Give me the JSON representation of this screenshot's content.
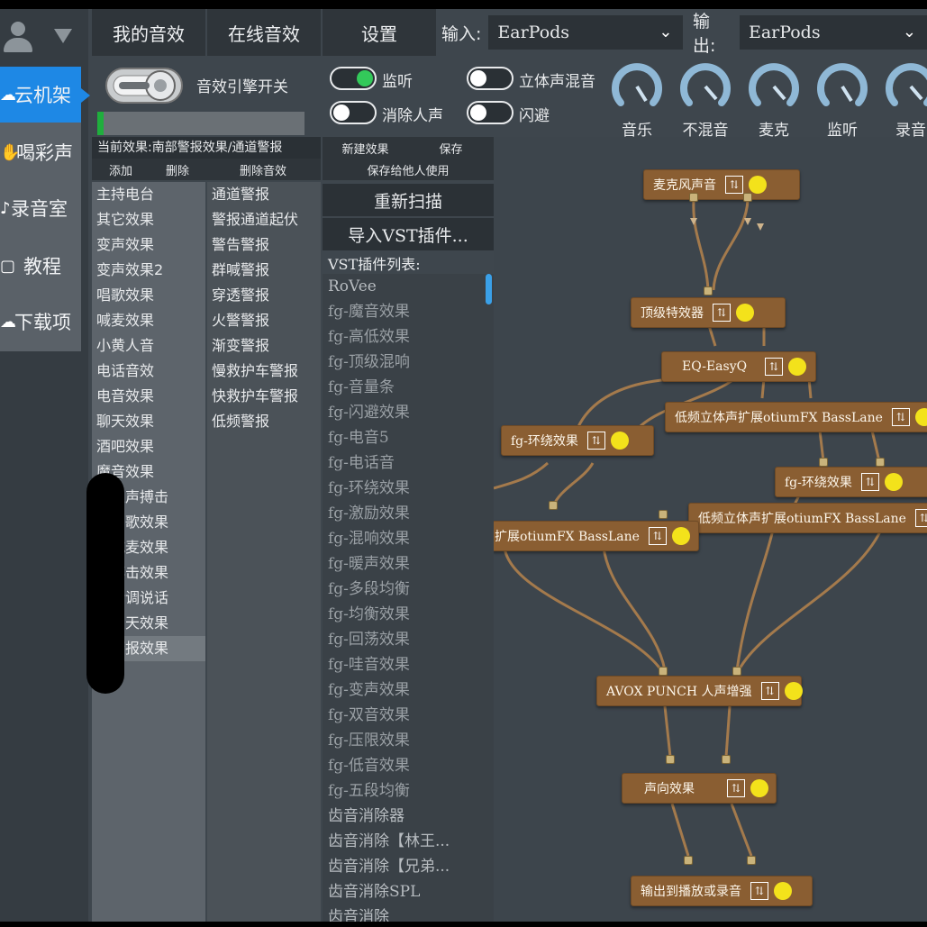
{
  "nav": {
    "items": [
      {
        "label": "云机架",
        "icon": "cloud-icon"
      },
      {
        "label": "喝彩声",
        "icon": "applause-icon"
      },
      {
        "label": "录音室",
        "icon": "studio-icon"
      },
      {
        "label": "教程",
        "icon": "tutorial-icon"
      },
      {
        "label": "下载项",
        "icon": "download-icon"
      }
    ]
  },
  "tabs": [
    "我的音效",
    "在线音效",
    "设置"
  ],
  "io": {
    "input_label": "输入:",
    "input_value": "EarPods",
    "output_label": "输出:",
    "output_value": "EarPods"
  },
  "engine": {
    "label": "音效引擎开关",
    "level_fraction": 0.03
  },
  "toggles": [
    {
      "label": "监听",
      "on": true
    },
    {
      "label": "立体声混音",
      "on": false
    },
    {
      "label": "消除人声",
      "on": false
    },
    {
      "label": "闪避",
      "on": false
    }
  ],
  "knobs": [
    "音乐",
    "不混音",
    "麦克",
    "监听",
    "录音"
  ],
  "preset": {
    "current": "当前效果:南部警报效果/通道警报",
    "add": "添加",
    "delete": "删除",
    "delete_fx": "删除音效",
    "list1": [
      "主持电台",
      "其它效果",
      "变声效果",
      "变声效果2",
      "唱歌效果",
      "喊麦效果",
      "小黄人音",
      "电话音效",
      "电音效果",
      "聊天效果",
      "酒吧效果",
      "魔音效果",
      "部人声搏击",
      "部唱歌效果",
      "部喊麦效果",
      "部搏击效果",
      "部精调说话",
      "部聊天效果",
      "部警报效果"
    ],
    "list1_selected": 18,
    "list2": [
      "通道警报",
      "警报通道起伏",
      "警告警报",
      "群喊警报",
      "穿透警报",
      "火警警报",
      "渐变警报",
      "慢救护车警报",
      "快救护车警报",
      "低频警报"
    ]
  },
  "vst": {
    "new_fx": "新建效果",
    "save": "保存",
    "save_share": "保存给他人使用",
    "rescan": "重新扫描",
    "import": "导入VST插件...",
    "list_header": "VST插件列表:",
    "items": [
      "RoVee",
      "fg-魔音效果",
      "fg-高低效果",
      "fg-顶级混响",
      "fg-音量条",
      "fg-闪避效果",
      "fg-电音5",
      "fg-电话音",
      "fg-环绕效果",
      "fg-激励效果",
      "fg-混响效果",
      "fg-暖声效果",
      "fg-多段均衡",
      "fg-均衡效果",
      "fg-回荡效果",
      "fg-哇音效果",
      "fg-变声效果",
      "fg-双音效果",
      "fg-压限效果",
      "fg-低音效果",
      "fg-五段均衡",
      "齿音消除器",
      "齿音消除【林王...",
      "齿音消除【兄弟...",
      "齿音消除SPL",
      "齿音消除"
    ]
  },
  "graph": {
    "nodes": [
      "麦克风声音",
      "顶级特效器",
      "EQ-EasyQ",
      "低频立体声扩展otiumFX BassLane",
      "fg-环绕效果",
      "fg-环绕效果",
      "低频立体声扩展otiumFX BassLane",
      "扩展otiumFX BassLane",
      "AVOX PUNCH 人声增强",
      "声向效果",
      "输出到播放或录音"
    ]
  },
  "colors": {
    "accent": "#1e88e5",
    "node": "#8a5e32",
    "led": "#f3e21b",
    "wire": "#a47a4c",
    "toggle_on": "#33c95a"
  }
}
